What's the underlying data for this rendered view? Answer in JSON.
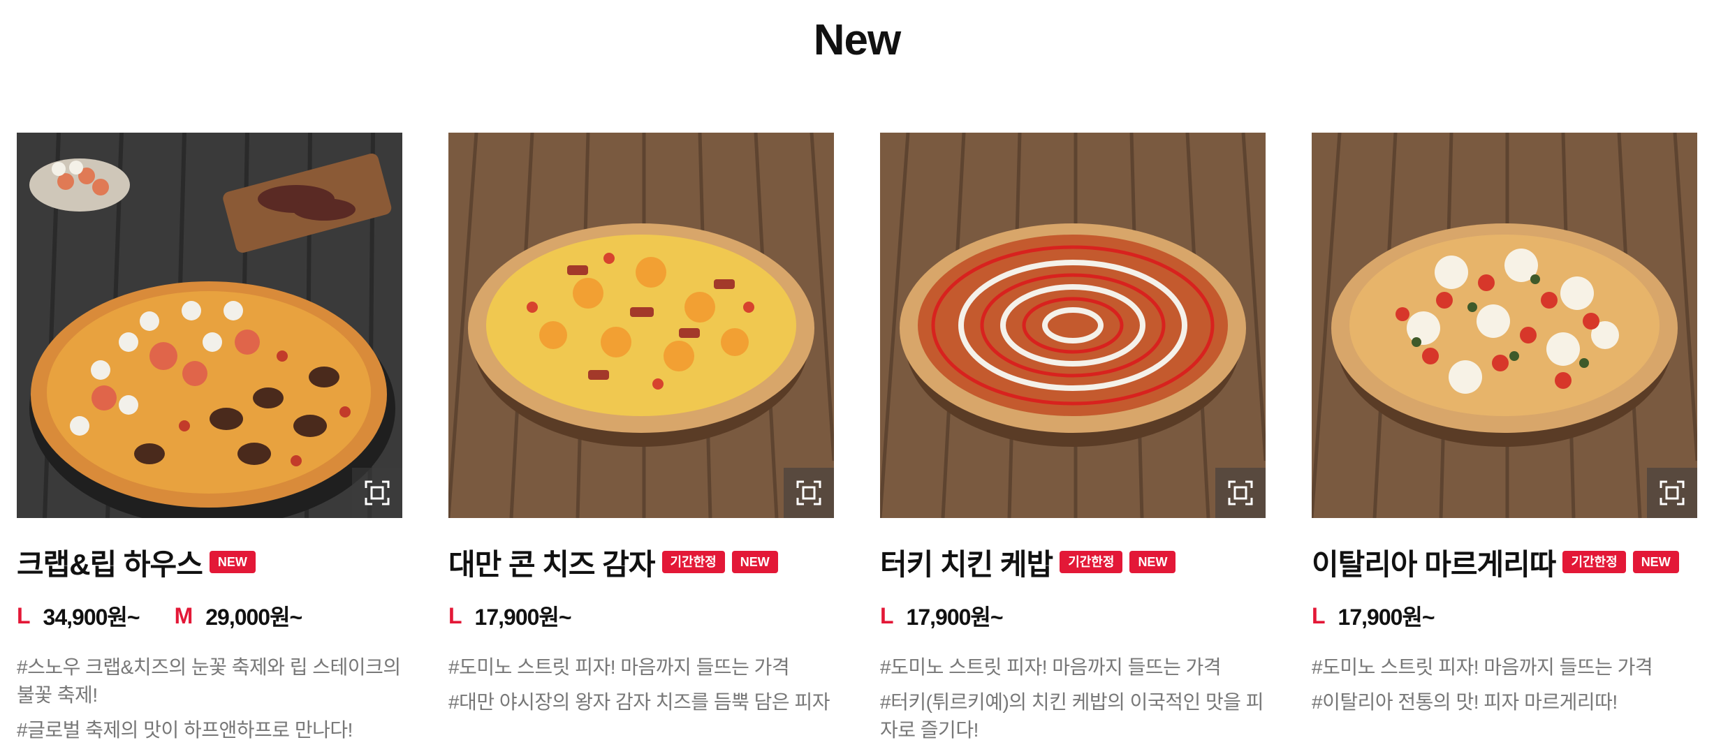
{
  "section": {
    "title": "New"
  },
  "products": [
    {
      "name": "크랩&립 하우스",
      "badges": [
        "NEW"
      ],
      "prices": [
        {
          "size": "L",
          "price": "34,900원~"
        },
        {
          "size": "M",
          "price": "29,000원~"
        }
      ],
      "descriptions": [
        "#스노우 크랩&치즈의 눈꽃 축제와 립 스테이크의 불꽃 축제!",
        "#글로벌 축제의 맛이 하프앤하프로 만나다!"
      ]
    },
    {
      "name": "대만 콘 치즈 감자",
      "badges": [
        "기간한정",
        "NEW"
      ],
      "prices": [
        {
          "size": "L",
          "price": "17,900원~"
        }
      ],
      "descriptions": [
        "#도미노 스트릿 피자! 마음까지 들뜨는 가격",
        "#대만 야시장의 왕자 감자 치즈를 듬뿍 담은 피자"
      ]
    },
    {
      "name": "터키 치킨 케밥",
      "badges": [
        "기간한정",
        "NEW"
      ],
      "prices": [
        {
          "size": "L",
          "price": "17,900원~"
        }
      ],
      "descriptions": [
        "#도미노 스트릿 피자! 마음까지 들뜨는 가격",
        "#터키(튀르키예)의 치킨 케밥의 이국적인 맛을 피자로 즐기다!"
      ]
    },
    {
      "name": "이탈리아 마르게리따",
      "badges": [
        "기간한정",
        "NEW"
      ],
      "prices": [
        {
          "size": "L",
          "price": "17,900원~"
        }
      ],
      "descriptions": [
        "#도미노 스트릿 피자! 마음까지 들뜨는 가격",
        "#이탈리아 전통의 맛! 피자 마르게리따!"
      ]
    }
  ],
  "icons": {
    "zoom": "expand-icon"
  },
  "colors": {
    "brand_red": "#e31837",
    "text": "#111111",
    "muted": "#777777"
  }
}
